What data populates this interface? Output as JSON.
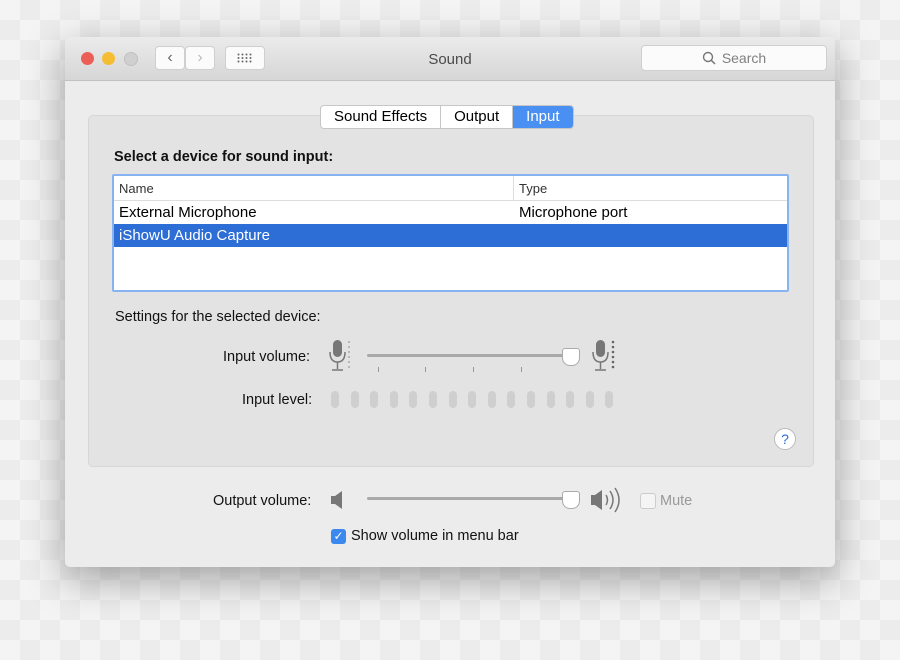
{
  "window": {
    "title": "Sound",
    "search_placeholder": "Search"
  },
  "tabs": [
    {
      "label": "Sound Effects",
      "selected": false
    },
    {
      "label": "Output",
      "selected": false
    },
    {
      "label": "Input",
      "selected": true
    }
  ],
  "input": {
    "heading": "Select a device for sound input:",
    "columns": [
      "Name",
      "Type"
    ],
    "devices": [
      {
        "name": "External Microphone",
        "type": "Microphone port",
        "selected": false
      },
      {
        "name": "iShowU Audio Capture",
        "type": "",
        "selected": true
      }
    ],
    "settings_label": "Settings for the selected device:",
    "input_volume_label": "Input volume:",
    "input_volume": 0.97,
    "input_level_label": "Input level:",
    "input_level": 0
  },
  "output_volume_label": "Output volume:",
  "output_volume": 0.97,
  "mute_label": "Mute",
  "mute_checked": false,
  "show_volume_label": "Show volume in menu bar",
  "show_volume_checked": true,
  "colors": {
    "accent": "#2c6dd6",
    "tab_selected": "#4a90f2"
  }
}
